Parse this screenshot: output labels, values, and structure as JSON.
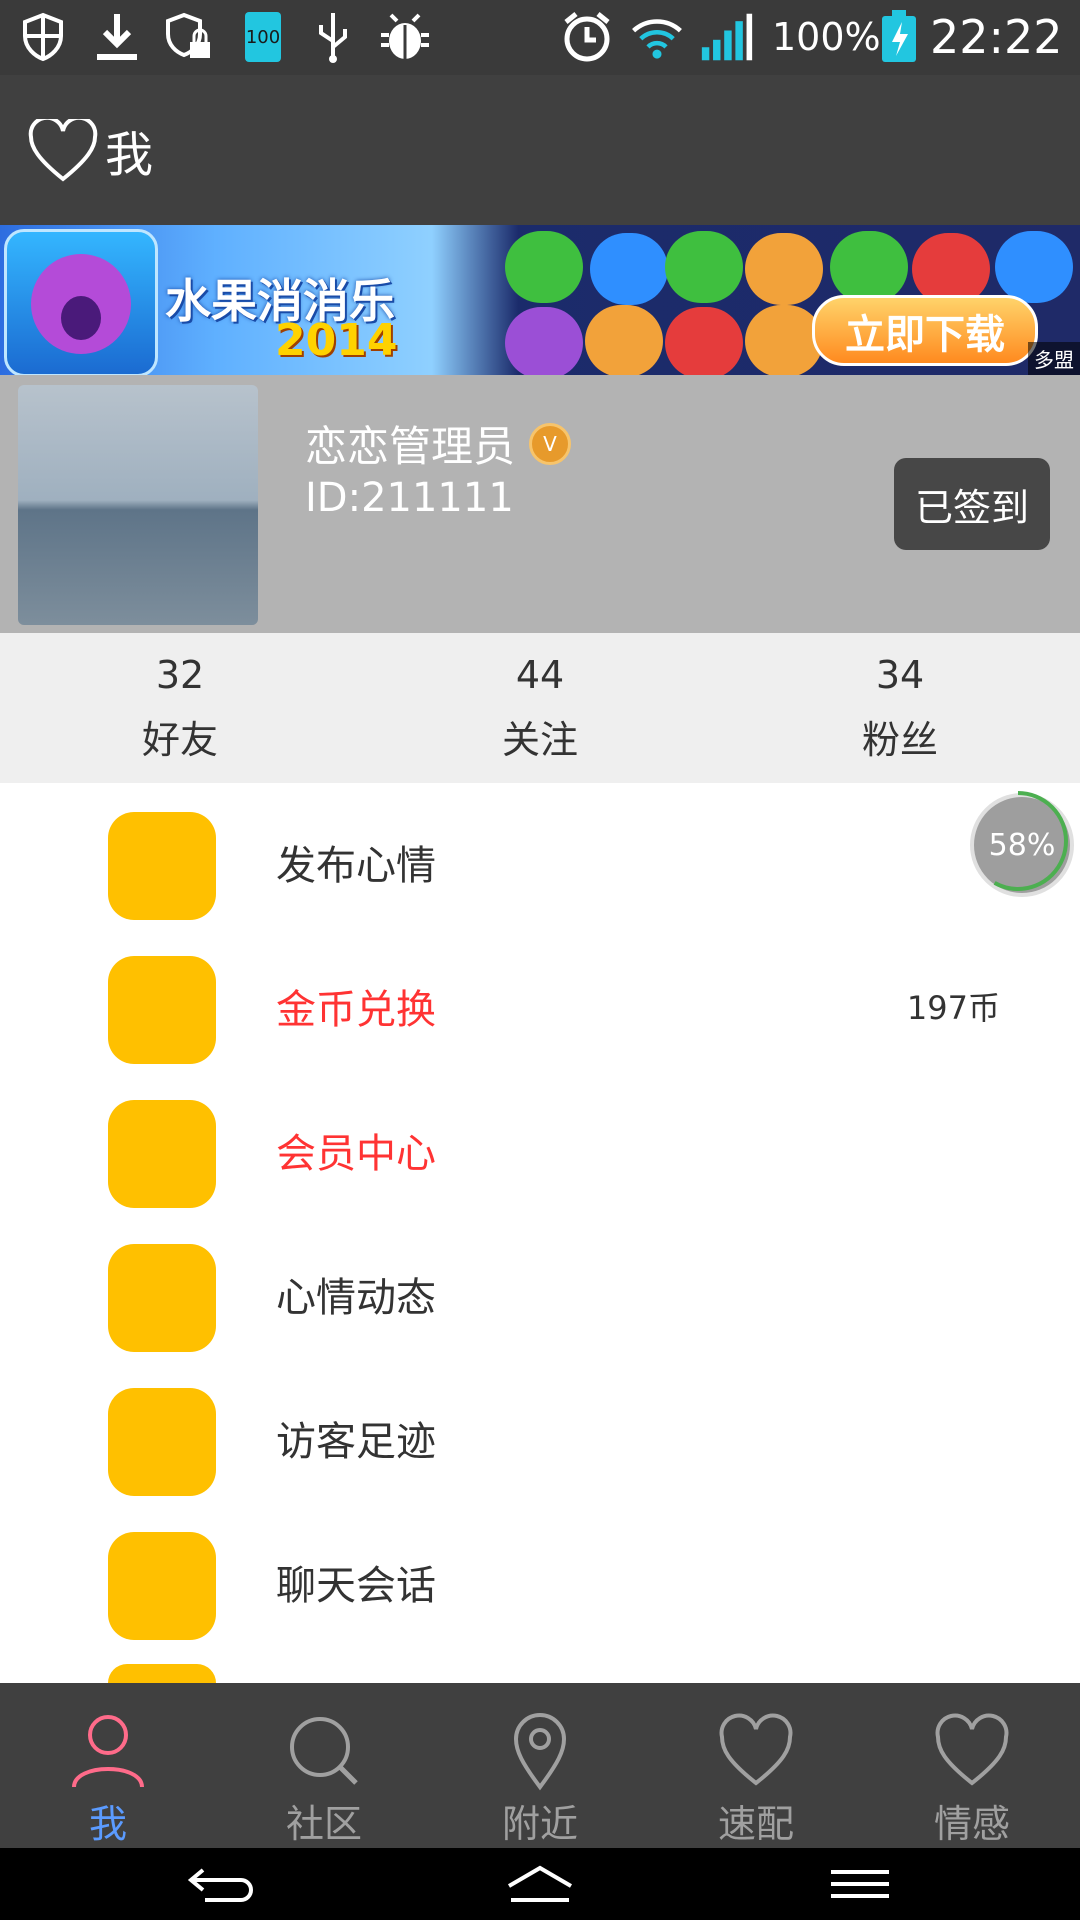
{
  "status_bar": {
    "battery_small": "100",
    "battery_percent": "100%",
    "time": "22:22"
  },
  "header": {
    "title": "我"
  },
  "banner": {
    "title": "水果消消乐",
    "year": "2014",
    "cta": "立即下载",
    "tag": "多盟"
  },
  "profile": {
    "name": "恋恋管理员",
    "id": "ID:211111",
    "signin": "已签到",
    "vip_badge": "V"
  },
  "stats": [
    {
      "value": "32",
      "label": "好友"
    },
    {
      "value": "44",
      "label": "关注"
    },
    {
      "value": "34",
      "label": "粉丝"
    }
  ],
  "menu": [
    {
      "label": "发布心情",
      "value": ""
    },
    {
      "label": "金币兑换",
      "value": "197币"
    },
    {
      "label": "会员中心",
      "value": ""
    },
    {
      "label": "心情动态",
      "value": ""
    },
    {
      "label": "访客足迹",
      "value": ""
    },
    {
      "label": "聊天会话",
      "value": ""
    }
  ],
  "progress": {
    "text": "58%"
  },
  "tabs": [
    {
      "label": "我"
    },
    {
      "label": "社区"
    },
    {
      "label": "附近"
    },
    {
      "label": "速配"
    },
    {
      "label": "情感"
    }
  ],
  "colors": {
    "accent_icon": "#ffc000",
    "red_label": "#ff3333",
    "active_tab": "#5b9bff"
  }
}
